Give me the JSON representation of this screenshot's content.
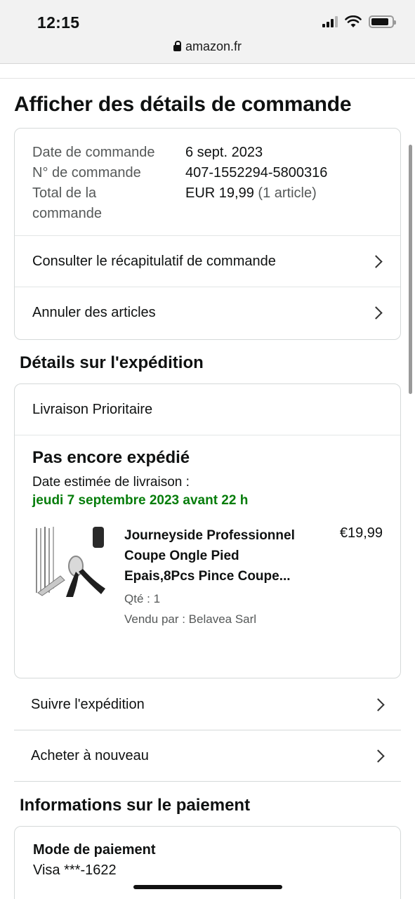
{
  "status_bar": {
    "time": "12:15",
    "url": "amazon.fr"
  },
  "page": {
    "title": "Afficher des détails de commande"
  },
  "summary": {
    "date_label": "Date de commande",
    "date_value": "6 sept. 2023",
    "number_label": "N° de commande",
    "number_value": "407-1552294-5800316",
    "total_label_1": "Total de la",
    "total_label_2": "commande",
    "total_value": "EUR 19,99",
    "total_count": "(1 article)"
  },
  "order_links": {
    "recap": "Consulter le récapitulatif de commande",
    "cancel": "Annuler des articles"
  },
  "shipping": {
    "section_title": "Détails sur l'expédition",
    "method": "Livraison Prioritaire",
    "status": "Pas encore expédié",
    "estimated_label": "Date estimée de livraison :",
    "estimated_date": "jeudi 7 septembre 2023 avant 22 h",
    "item": {
      "title": "Journeyside Professionnel Coupe Ongle Pied Epais,8Pcs Pince Coupe...",
      "qty": "Qté : 1",
      "seller": "Vendu par : Belavea Sarl",
      "price": "€19,99"
    },
    "track": "Suivre l'expédition",
    "buy_again": "Acheter à nouveau"
  },
  "payment": {
    "section_title": "Informations sur le paiement",
    "method_label": "Mode de paiement",
    "method_value": "Visa ***-1622"
  },
  "colors": {
    "delivery_green": "#067d0b",
    "muted": "#565959",
    "border": "#d5d9d9"
  },
  "icons": [
    "lock-icon",
    "signal-icon",
    "wifi-icon",
    "battery-icon",
    "chevron-right-icon"
  ]
}
